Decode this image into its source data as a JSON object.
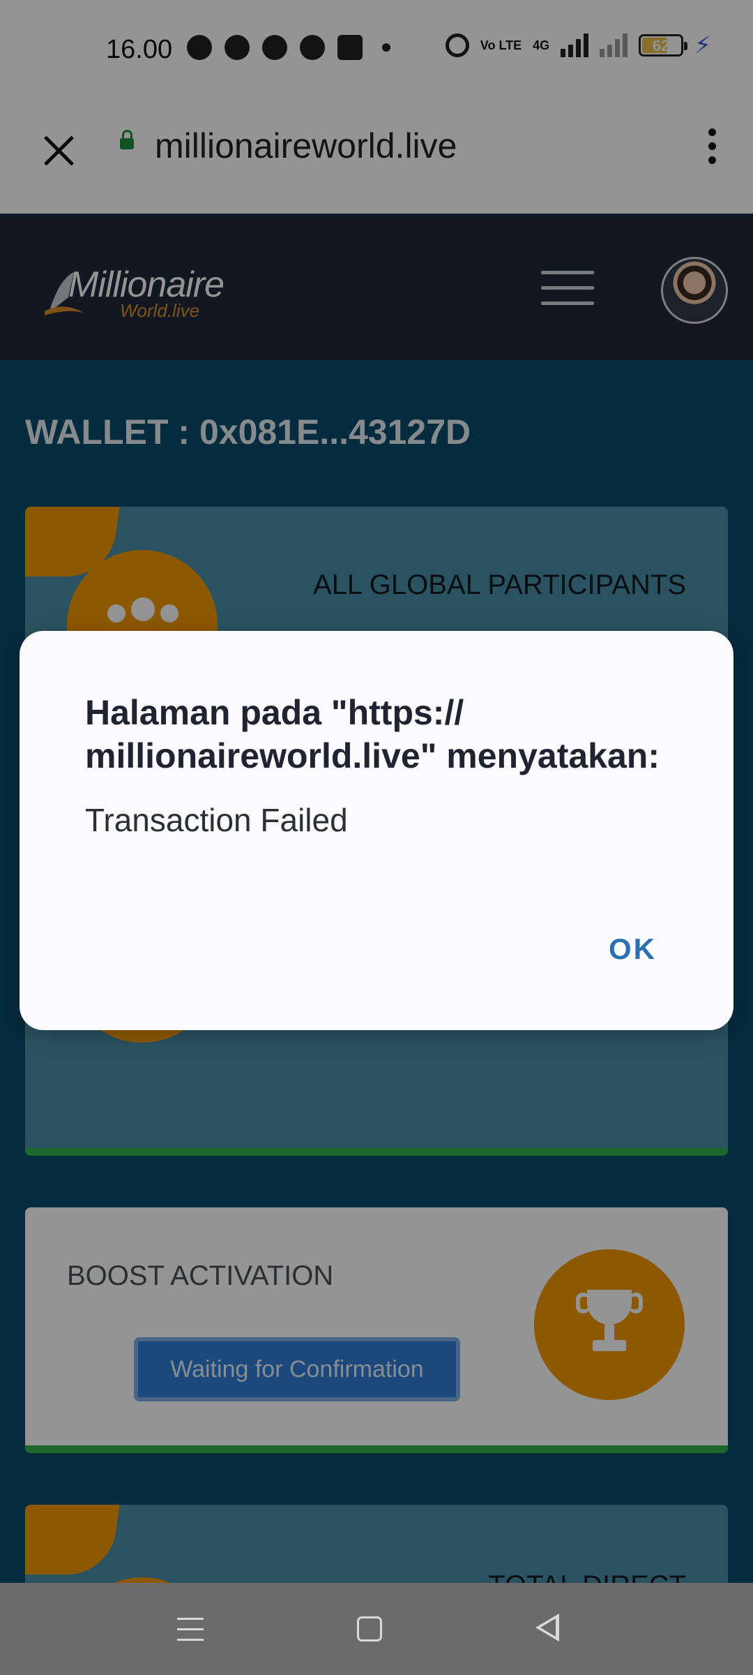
{
  "status_bar": {
    "time": "16.00",
    "network_label": "4G",
    "volte_label": "Vo LTE",
    "battery_level": "62",
    "icons": [
      "whatsapp-icon",
      "telegram-icon",
      "messenger-icon",
      "chat-icon",
      "tapatalk-icon",
      "dot-icon",
      "alarm-icon",
      "volte-icon",
      "signal-icon",
      "signal-icon-2",
      "battery-icon",
      "charging-icon"
    ]
  },
  "browser": {
    "url": "millionaireworld.live",
    "icons": [
      "close-icon",
      "lock-icon",
      "kebab-menu-icon"
    ]
  },
  "site_header": {
    "logo_main": "Millionaire",
    "logo_sub": "World.live",
    "icons": [
      "hamburger-icon",
      "avatar"
    ]
  },
  "page": {
    "wallet_label": "WALLET : 0x081E...43127D",
    "cards": {
      "global": {
        "title": "ALL GLOBAL PARTICIPANTS"
      },
      "boost": {
        "title": "BOOST ACTIVATION",
        "button_label": "Waiting for Confirmation"
      },
      "direct": {
        "title": "TOTAL DIRECT"
      }
    }
  },
  "dialog": {
    "title": "Halaman pada \"https:// millionaireworld.live\" menyatakan:",
    "message": "Transaction Failed",
    "ok_label": "OK"
  },
  "colors": {
    "accent_orange": "#f29a05",
    "header_bg": "#1e2a3a",
    "content_bg": "#0a4a6c",
    "button_blue": "#2f7fd7",
    "ok_blue": "#2d6fb1",
    "progress_green": "#2fb34a"
  }
}
